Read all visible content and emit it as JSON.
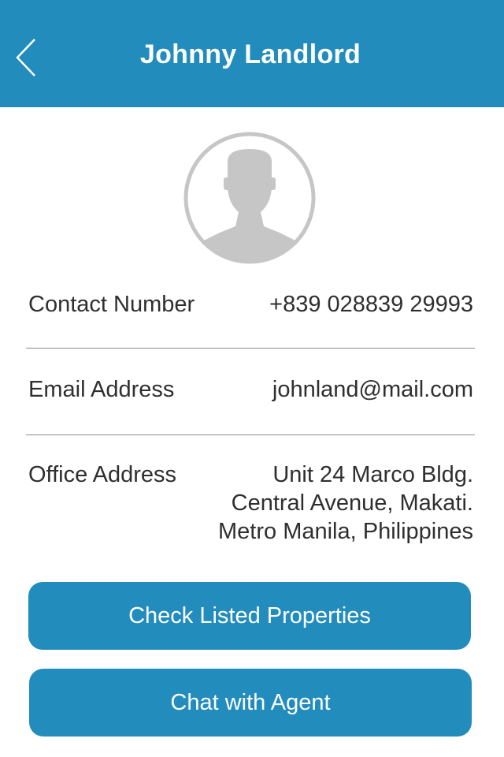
{
  "header": {
    "title": "Johnny Landlord",
    "back_icon": "chevron-left-icon",
    "background": "#228cbd"
  },
  "profile": {
    "avatar_icon": "user-silhouette-icon"
  },
  "details": {
    "contact": {
      "label": "Contact Number",
      "value": "+839 028839 29993"
    },
    "email": {
      "label": "Email Address",
      "value": "johnland@mail.com"
    },
    "office": {
      "label": "Office Address",
      "lines": [
        "Unit 24 Marco Bldg.",
        "Central Avenue, Makati.",
        "Metro Manila, Philippines"
      ]
    }
  },
  "actions": {
    "check_listed": "Check Listed Properties",
    "chat_agent": "Chat with Agent"
  },
  "colors": {
    "accent": "#228cbd",
    "text": "#2f2f2f",
    "avatar_gray": "#c6c6c6"
  }
}
